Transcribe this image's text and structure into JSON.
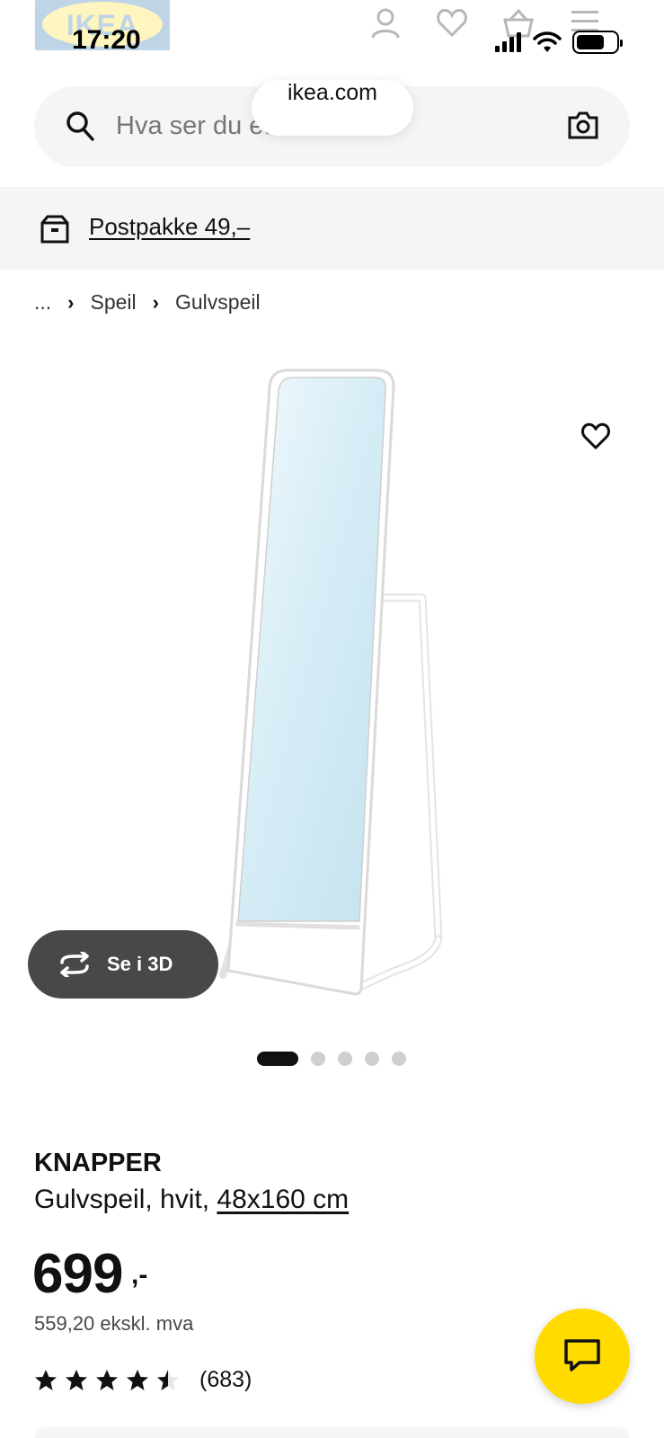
{
  "status_bar": {
    "time": "17:20"
  },
  "header": {
    "logo_text": "IKEA",
    "search": {
      "placeholder": "Hva ser du etter?"
    },
    "url": "ikea.com"
  },
  "banner": {
    "text": "Postpakke 49,–"
  },
  "breadcrumb": {
    "ellipsis": "...",
    "items": [
      "Speil",
      "Gulvspeil"
    ]
  },
  "media": {
    "view_3d_label": "Se i 3D",
    "dot_count": 5,
    "active_dot": 0
  },
  "product": {
    "name": "KNAPPER",
    "description": "Gulvspeil, hvit,",
    "size": "48x160 cm",
    "price": "699",
    "price_suffix": ",-",
    "price_ex_vat": "559,20 ekskl. mva",
    "rating": 4.5,
    "review_count": "(683)"
  },
  "colors": {
    "brand_yellow": "#FFDB00",
    "brand_blue": "#0058A3",
    "dark_button": "#484848"
  },
  "icons": [
    "search-icon",
    "camera-icon",
    "user-icon",
    "heart-icon",
    "basket-icon",
    "menu-icon",
    "box-icon",
    "rotate-3d-icon",
    "chat-icon",
    "star-icon"
  ]
}
